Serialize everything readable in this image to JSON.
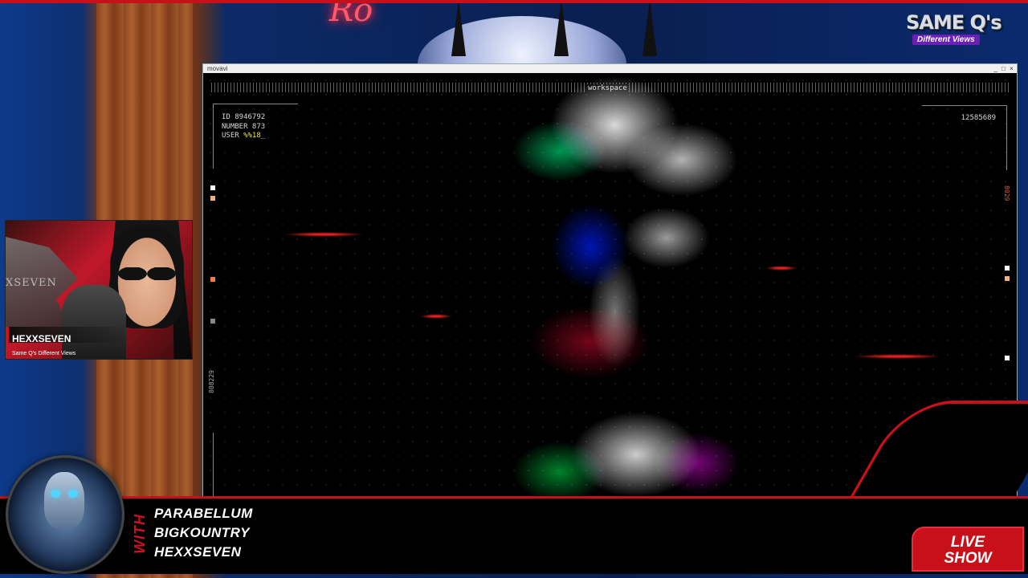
{
  "brand": {
    "logo_main": "SAME Q's",
    "logo_sub": "Different Views"
  },
  "window": {
    "title": "movavi",
    "controls": [
      "_",
      "□",
      "×"
    ],
    "workspace_label": "workspace",
    "info": {
      "id_line": "ID 8946792",
      "number_line": "NUMBER 873",
      "user_prefix": "USER ",
      "user_value": "%%18_"
    },
    "top_right_number": "12585689",
    "left_vertical_text": "808229",
    "right_vertical_text": "8029"
  },
  "webcam": {
    "logo_text": "XSEVEN",
    "name": "HEXXSEVEN",
    "subtitle": "Same Q's Different Views"
  },
  "lower_third": {
    "with_label": "WITH",
    "hosts": [
      "PARABELLUM",
      "BIGKOUNTRY",
      "HEXXSEVEN"
    ],
    "live_label_line1": "LIVE",
    "live_label_line2": "SHOW"
  },
  "colors": {
    "accent_red": "#c8101a",
    "logo_purple": "#6a1fb5",
    "info_accent": "#e9e35a"
  }
}
